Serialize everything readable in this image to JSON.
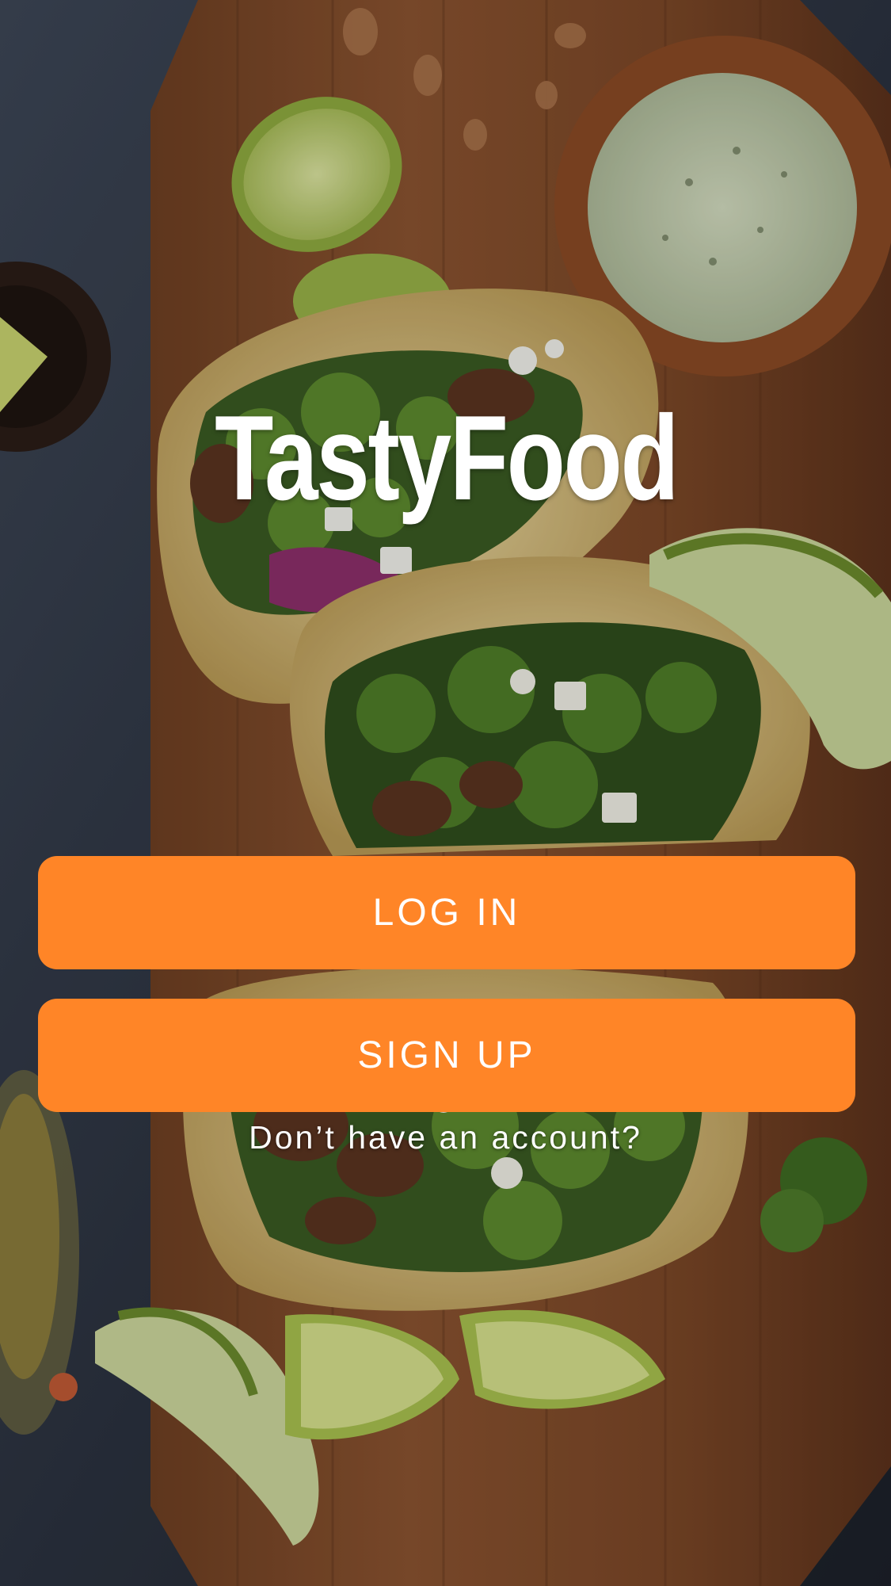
{
  "app": {
    "title": "TastyFood"
  },
  "actions": {
    "login_label": "LOG IN",
    "signup_label": "SIGN UP",
    "no_account_text": "Don’t have an account?"
  },
  "colors": {
    "accent": "#FF8527",
    "text_on_accent": "#FFFFFF",
    "background_dark": "#2A2F3A",
    "board_wood": "#7A4A2C"
  },
  "background": {
    "description_icon": "tacos-photo"
  }
}
